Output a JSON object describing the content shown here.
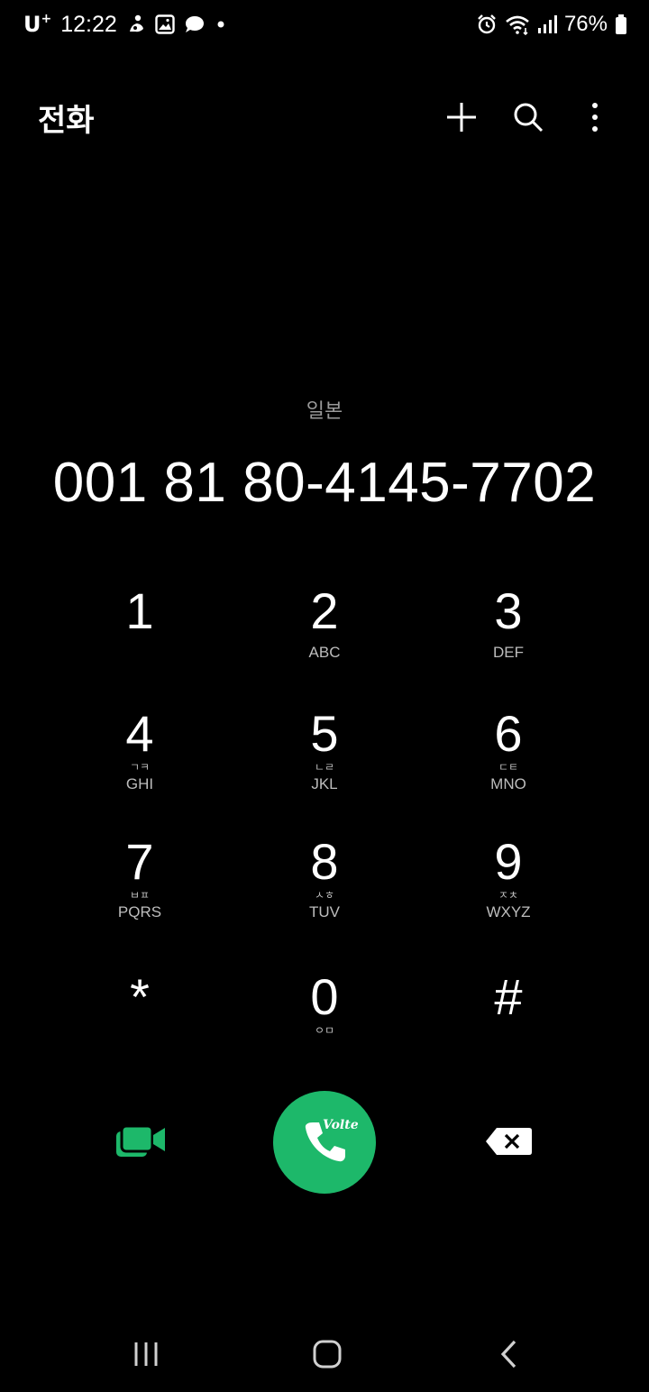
{
  "status_bar": {
    "carrier": "U",
    "carrier_sup": "+",
    "time": "12:22",
    "battery": "76%",
    "icons": [
      "tao-icon",
      "gallery-icon",
      "chat-bubble-icon",
      "dot-icon",
      "alarm-icon",
      "wifi-icon",
      "signal-icon",
      "battery-icon"
    ]
  },
  "app_bar": {
    "title": "전화",
    "actions": [
      "add-icon",
      "search-icon",
      "more-options-icon"
    ]
  },
  "dialer": {
    "country": "일본",
    "number": "001 81 80-4145-7702"
  },
  "keypad": {
    "keys": [
      {
        "digit": "1",
        "korean": "",
        "letters": ""
      },
      {
        "digit": "2",
        "korean": "",
        "letters": "ABC"
      },
      {
        "digit": "3",
        "korean": "",
        "letters": "DEF"
      },
      {
        "digit": "4",
        "korean": "ㄱㅋ",
        "letters": "GHI"
      },
      {
        "digit": "5",
        "korean": "ㄴㄹ",
        "letters": "JKL"
      },
      {
        "digit": "6",
        "korean": "ㄷㅌ",
        "letters": "MNO"
      },
      {
        "digit": "7",
        "korean": "ㅂㅍ",
        "letters": "PQRS"
      },
      {
        "digit": "8",
        "korean": "ㅅㅎ",
        "letters": "TUV"
      },
      {
        "digit": "9",
        "korean": "ㅈㅊ",
        "letters": "WXYZ"
      },
      {
        "digit": "*",
        "korean": "",
        "letters": ""
      },
      {
        "digit": "0",
        "korean": "ㅇㅁ",
        "letters": ""
      },
      {
        "digit": "#",
        "korean": "",
        "letters": ""
      }
    ]
  },
  "actions": {
    "volte_label": "Volte",
    "accent_color": "#1db86a"
  },
  "nav_bar": {
    "buttons": [
      "recent-apps-icon",
      "home-icon",
      "back-icon"
    ]
  }
}
